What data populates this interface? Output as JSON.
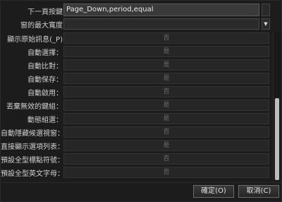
{
  "form": {
    "next_page_key": {
      "label": "下一頁按鍵",
      "value": "Page_Down,period,equal"
    },
    "max_width": {
      "label": "窗的最大寬度",
      "value": ""
    },
    "options": [
      {
        "label": "顯示原始訊息(_P)",
        "value": "否"
      },
      {
        "label": "自動選擇：",
        "value": "是"
      },
      {
        "label": "自動比對：",
        "value": "是"
      },
      {
        "label": "自動保存：",
        "value": "是"
      },
      {
        "label": "自動啟用：",
        "value": "否"
      },
      {
        "label": "丟棄無效的鍵組：",
        "value": "是"
      },
      {
        "label": "動態組選：",
        "value": "是"
      },
      {
        "label": "自動隱藏候選視窗：",
        "value": "否"
      },
      {
        "label": "直接顯示選項列表：",
        "value": "是"
      },
      {
        "label": "預設全型標點符號：",
        "value": "否"
      },
      {
        "label": "預設全型英文字母：",
        "value": "否"
      }
    ]
  },
  "buttons": {
    "ok": "確定(O)",
    "cancel": "取消(C)"
  }
}
